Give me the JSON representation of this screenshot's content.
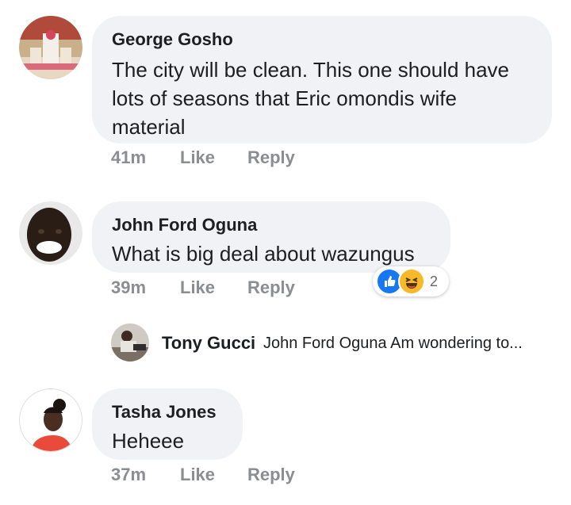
{
  "comments": [
    {
      "author": "George Gosho",
      "text_lines": [
        "The city will be clean. This one should have",
        "lots of seasons that Eric omondis wife",
        "material"
      ],
      "time": "41m",
      "like_label": "Like",
      "reply_label": "Reply",
      "avatar_icon": "wedding-cake-photo"
    },
    {
      "author": "John Ford Oguna",
      "text_lines": [
        "What is big deal about wazungus"
      ],
      "time": "39m",
      "like_label": "Like",
      "reply_label": "Reply",
      "avatar_icon": "smiling-man-photo",
      "reactions": {
        "icons": [
          "like-reaction-icon",
          "haha-reaction-icon"
        ],
        "count": "2"
      }
    },
    {
      "author": "Tasha Jones",
      "text_lines": [
        "Heheee"
      ],
      "time": "37m",
      "like_label": "Like",
      "reply_label": "Reply",
      "avatar_icon": "woman-portrait-photo"
    }
  ],
  "reply_preview": {
    "author": "Tony Gucci",
    "text": "John Ford Oguna  Am wondering to...",
    "avatar_icon": "man-sitting-photo"
  },
  "colors": {
    "bubble": "#f0f2f5",
    "meta_text": "#8a8d91",
    "like_blue": "#1877f2",
    "haha_yellow": "#f7b928"
  }
}
